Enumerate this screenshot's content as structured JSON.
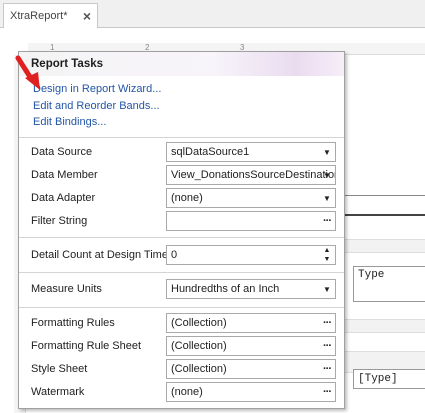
{
  "tab": {
    "title": "XtraReport*",
    "close_glyph": "×"
  },
  "ruler": {
    "marks": [
      "1",
      "2",
      "3"
    ]
  },
  "designer": {
    "label_type_1": "Type",
    "label_type_2": "[Type]"
  },
  "panel": {
    "title": "Report Tasks",
    "links": {
      "wizard": "Design in Report Wizard...",
      "bands": "Edit and Reorder Bands...",
      "bindings": "Edit Bindings..."
    },
    "rows": {
      "data_source": {
        "label": "Data Source",
        "value": "sqlDataSource1"
      },
      "data_member": {
        "label": "Data Member",
        "value": "View_DonationsSourceDestination"
      },
      "data_adapter": {
        "label": "Data Adapter",
        "value": "(none)"
      },
      "filter_string": {
        "label": "Filter String",
        "value": ""
      },
      "detail_count": {
        "label": "Detail Count at Design Time",
        "value": "0"
      },
      "measure_units": {
        "label": "Measure Units",
        "value": "Hundredths of an Inch"
      },
      "formatting_rules": {
        "label": "Formatting Rules",
        "value": "(Collection)"
      },
      "formatting_rule_sheet": {
        "label": "Formatting Rule Sheet",
        "value": "(Collection)"
      },
      "style_sheet": {
        "label": "Style Sheet",
        "value": "(Collection)"
      },
      "watermark": {
        "label": "Watermark",
        "value": "(none)"
      }
    }
  },
  "icons": {
    "dropdown": "chevron-down-icon",
    "ellipsis": "ellipsis-icon",
    "spin": "spin-up-down-icon",
    "arrow": "red-arrow-icon"
  },
  "colors": {
    "link": "#2256a8",
    "arrow": "#e02020"
  }
}
